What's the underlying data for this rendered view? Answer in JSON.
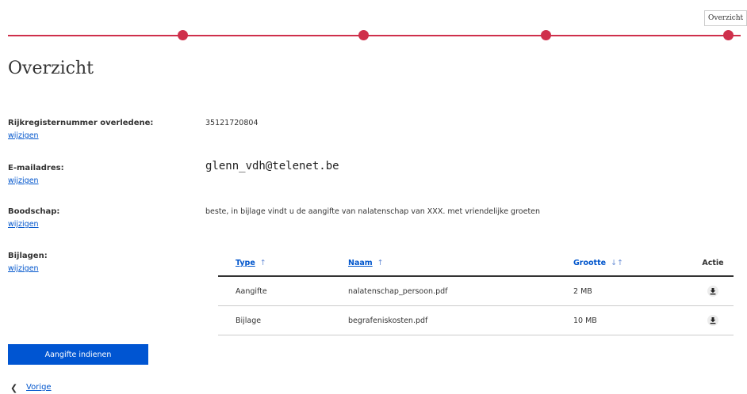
{
  "stepper": {
    "current_step_label": "Overzicht"
  },
  "page_title": "Overzicht",
  "fields": [
    {
      "label": "Rijkregisternummer overledene:",
      "edit": "wijzigen",
      "value": "35121720804"
    },
    {
      "label": "E-mailadres:",
      "edit": "wijzigen",
      "value": "glenn_vdh@telenet.be"
    },
    {
      "label": "Boodschap:",
      "edit": "wijzigen",
      "value": "beste, in bijlage vindt u de aangifte van nalatenschap van XXX. met vriendelijke groeten"
    },
    {
      "label": "Bijlagen:",
      "edit": "wijzigen"
    }
  ],
  "table": {
    "headers": {
      "type": "Type",
      "naam": "Naam",
      "grootte": "Grootte",
      "actie": "Actie"
    },
    "rows": [
      {
        "type": "Aangifte",
        "naam": "nalatenschap_persoon.pdf",
        "grootte": "2 MB",
        "action_icon": "download-icon"
      },
      {
        "type": "Bijlage",
        "naam": "begrafeniskosten.pdf",
        "grootte": "10 MB",
        "action_icon": "download-icon"
      }
    ]
  },
  "submit_label": "Aangifte indienen",
  "prev_label": "Vorige",
  "colors": {
    "accent_red": "#cf2f4b",
    "link_blue": "#0055cc",
    "button_blue": "#0055d2"
  }
}
